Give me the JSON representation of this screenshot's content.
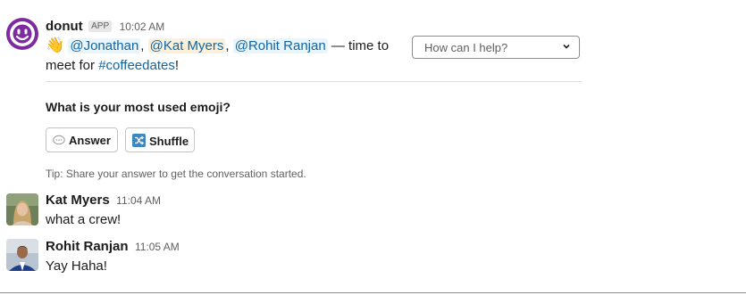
{
  "donut": {
    "name": "donut",
    "badge": "APP",
    "time": "10:02 AM",
    "wave": "👋",
    "mentions": [
      "@Jonathan",
      "@Kat Myers",
      "@Rohit Ranjan"
    ],
    "comma": ",",
    "text_after": "— time to",
    "line2_prefix": "meet for",
    "channel": "#coffeedates",
    "excl": "!",
    "select_placeholder": "How can I help?",
    "question": "What is your most used emoji?",
    "answer_label": "Answer",
    "shuffle_label": "Shuffle",
    "tip": "Tip: Share your answer to get the conversation started."
  },
  "messages": [
    {
      "name": "Kat Myers",
      "time": "11:04 AM",
      "text": "what a crew!"
    },
    {
      "name": "Rohit Ranjan",
      "time": "11:05 AM",
      "text": "Yay Haha!"
    }
  ]
}
